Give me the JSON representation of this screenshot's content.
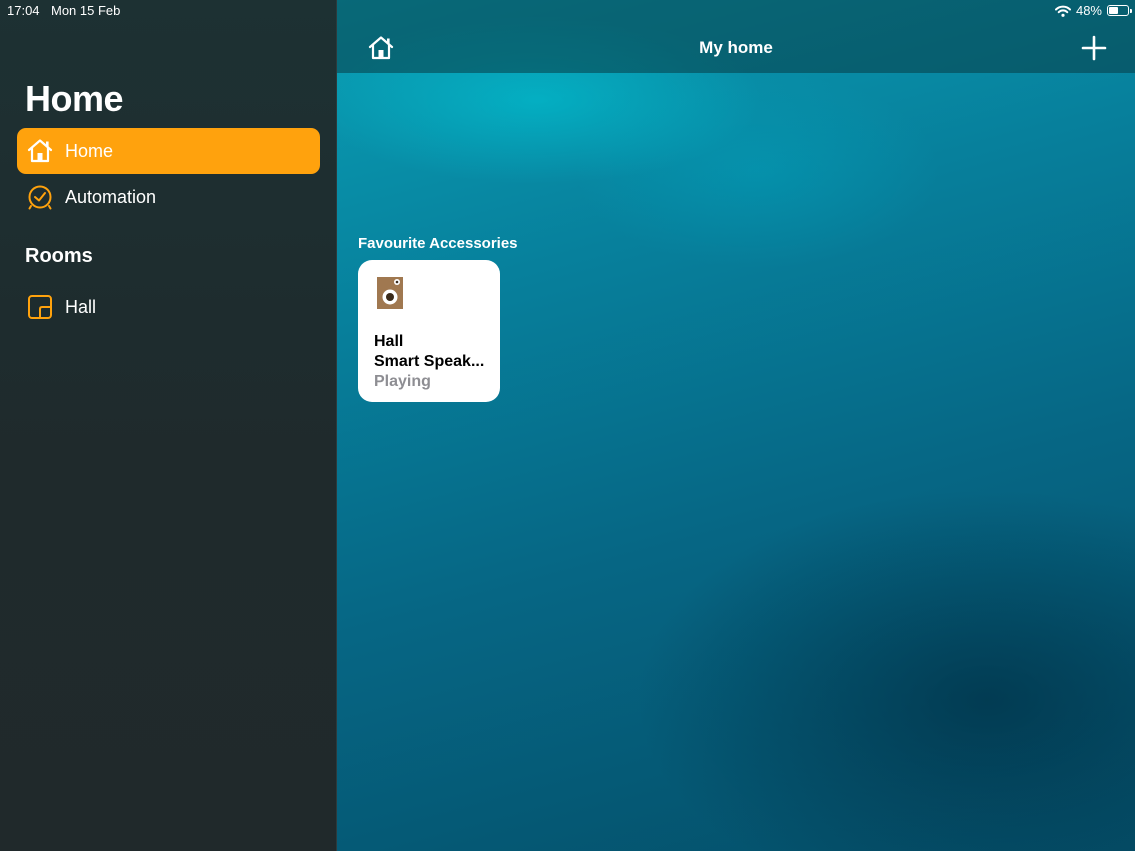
{
  "status_bar": {
    "time": "17:04",
    "date": "Mon 15 Feb",
    "battery": "48%",
    "battery_level": 0.48
  },
  "sidebar": {
    "title": "Home",
    "nav": [
      {
        "label": "Home",
        "icon": "house-icon",
        "active": true
      },
      {
        "label": "Automation",
        "icon": "clock-icon",
        "active": false
      }
    ],
    "rooms_title": "Rooms",
    "rooms": [
      {
        "label": "Hall",
        "icon": "room-icon"
      }
    ]
  },
  "header": {
    "title": "My home",
    "home_icon": "house-icon",
    "add_icon": "plus-icon"
  },
  "main": {
    "section_label": "Favourite Accessories",
    "tiles": [
      {
        "room": "Hall",
        "name": "Smart Speak...",
        "status": "Playing",
        "icon": "speaker-icon"
      }
    ]
  },
  "colors": {
    "accent": "#ffa20d",
    "sidebar_bg": "#1f2a2c",
    "wallpaper": "#07809c",
    "tile_bg": "#ffffff",
    "status_gray": "#8e8e93"
  }
}
